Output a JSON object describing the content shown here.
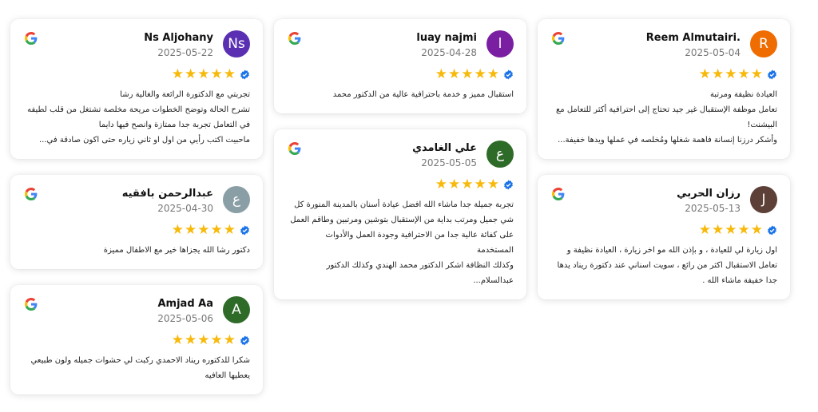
{
  "brand_colors": {
    "star": "#f7b90a",
    "verified": "#1a73e8"
  },
  "reviews": [
    {
      "name": "Ns Aljohany",
      "date": "2025-05-22",
      "initial": "Ns",
      "avatar_color": "#5b2fb2",
      "stars": 5,
      "text": "تجربتي مع الدكتورة الرائعة والغالية رشا\nتشرح الحالة وتوضح الخطوات مريحة مخلصة تشتغل من قلب لطيفه\nفي التعامل تجربة جدا ممتازة وانصح فيها دايما\nماحبيت اكتب رأيي من اول او ثاني زياره حتى اكون صادقة في..."
    },
    {
      "name": "عبدالرحمن بافقيه",
      "date": "2025-04-30",
      "initial": "ع",
      "avatar_color": "#8a9ea6",
      "stars": 5,
      "text": "دكتور رشا الله يجزاها خير مع الاطفال مميزة"
    },
    {
      "name": "Amjad Aa",
      "date": "2025-05-06",
      "initial": "A",
      "avatar_color": "#2f6b28",
      "stars": 5,
      "text": "شكرا للدكتوره ريناد الاحمدي ركبت لي حشوات جميله ولون طبيعي\nيعطيها العافيه"
    },
    {
      "name": "luay najmi",
      "date": "2025-04-28",
      "initial": "l",
      "avatar_color": "#7b1fa2",
      "stars": 5,
      "text": "استقبال مميز و خدمة باحترافية عالية من الدكتور محمد"
    },
    {
      "name": "علي الغامدي",
      "date": "2025-05-05",
      "initial": "ع",
      "avatar_color": "#2f6b28",
      "stars": 5,
      "text": "تجربة جميلة جدا ماشاء الله افضل عيادة أسنان بالمدينة المنورة كل\nشي جميل ومرتب بداية من الإستقبال بتوشين ومرتبين وطاقم العمل\nعلى كفائة عالية جدا من الاحترافية وجودة العمل والأدوات المستخدمة\nوكذلك النظافة اشكر الدكتور محمد الهندي وكذلك الدكتور عبدالسلام..."
    },
    {
      "name": "Reem Almutairi.",
      "date": "2025-05-04",
      "initial": "R",
      "avatar_color": "#ef6c00",
      "stars": 5,
      "text": "العيادة نظيفة ومرتبة\nتعامل موظفة الإستقبال غير جيد تحتاج إلى احترافية أكثر للتعامل مع\nالبيشنت!\nوأشكر درزنا إنسانة فاهمة شغلها ومُخلصه في عملها ويدها خفيفة..."
    },
    {
      "name": "رزان الحربي",
      "date": "2025-05-13",
      "initial": "J",
      "avatar_color": "#5d4037",
      "stars": 5,
      "text": "اول زيارة لي للعيادة ، و بإذن الله مو اخر زيارة ، العيادة نظيفة و\nتعامل الاستقبال اكثر من رائع ، سويت اسناني عند دكتورة ريناد يدها\nجدا خفيفة ماشاء الله ."
    }
  ]
}
